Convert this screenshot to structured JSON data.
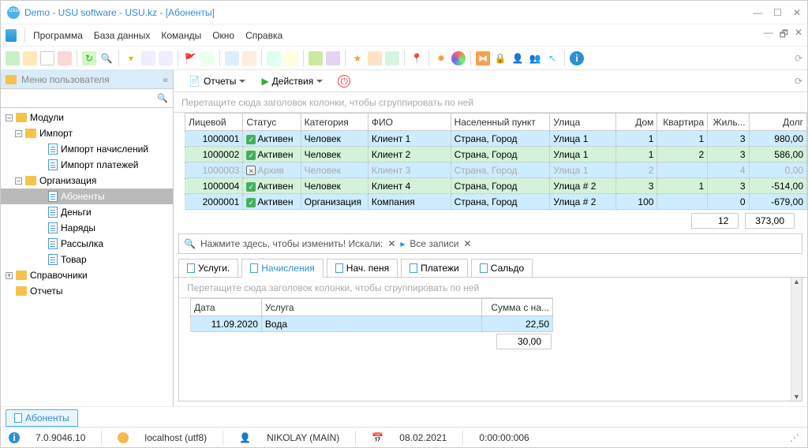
{
  "window": {
    "title": "Demo - USU software - USU.kz - [Абоненты]"
  },
  "menu": {
    "items": [
      "Программа",
      "База данных",
      "Команды",
      "Окно",
      "Справка"
    ]
  },
  "sidebar": {
    "header": "Меню пользователя",
    "tree": {
      "modules": "Модули",
      "import": "Импорт",
      "import_charges": "Импорт начислений",
      "import_payments": "Импорт платежей",
      "org": "Организация",
      "subscribers": "Абоненты",
      "money": "Деньги",
      "orders": "Наряды",
      "mail": "Рассылка",
      "goods": "Товар",
      "refs": "Справочники",
      "reports": "Отчеты"
    }
  },
  "subtoolbar": {
    "reports": "Отчеты",
    "actions": "Действия"
  },
  "group_hint": "Перетащите сюда заголовок колонки, чтобы сгруппировать по ней",
  "columns": [
    "Лицевой",
    "Статус",
    "Категория",
    "ФИО",
    "Населенный пункт",
    "Улица",
    "Дом",
    "Квартира",
    "Жиль...",
    "Долг"
  ],
  "rows": [
    {
      "acct": "1000001",
      "status": "Активен",
      "active": true,
      "cat": "Человек",
      "name": "Клиент 1",
      "city": "Страна, Город",
      "street": "Улица 1",
      "house": "1",
      "apt": "1",
      "res": "3",
      "debt": "980,00"
    },
    {
      "acct": "1000002",
      "status": "Активен",
      "active": true,
      "cat": "Человек",
      "name": "Клиент 2",
      "city": "Страна, Город",
      "street": "Улица 1",
      "house": "1",
      "apt": "2",
      "res": "3",
      "debt": "586,00"
    },
    {
      "acct": "1000003",
      "status": "Архив",
      "active": false,
      "cat": "Человек",
      "name": "Клиент 3",
      "city": "Страна, Город",
      "street": "Улица 1",
      "house": "2",
      "apt": "",
      "res": "4",
      "debt": "0,00"
    },
    {
      "acct": "1000004",
      "status": "Активен",
      "active": true,
      "cat": "Человек",
      "name": "Клиент 4",
      "city": "Страна, Город",
      "street": "Улица # 2",
      "house": "3",
      "apt": "1",
      "res": "3",
      "debt": "-514,00"
    },
    {
      "acct": "2000001",
      "status": "Активен",
      "active": true,
      "cat": "Организация",
      "name": "Компания",
      "city": "Страна, Город",
      "street": "Улица # 2",
      "house": "100",
      "apt": "",
      "res": "0",
      "debt": "-679,00"
    }
  ],
  "totals": {
    "residents": "12",
    "debt": "373,00"
  },
  "filter": {
    "prefix": "Нажмите здесь, чтобы изменить! Искали:",
    "all": "Все записи"
  },
  "detail_tabs": [
    "Услуги.",
    "Начисления",
    "Нач. пеня",
    "Платежи",
    "Сальдо"
  ],
  "detail_active_tab": 1,
  "detail_columns": [
    "Дата",
    "Услуга",
    "Сумма с на..."
  ],
  "detail_rows": [
    {
      "date": "11.09.2020",
      "service": "Вода",
      "amount": "22,50"
    }
  ],
  "detail_total": "30,00",
  "bottom_tab": "Абоненты",
  "status": {
    "version": "7.0.9046.10",
    "host": "localhost (utf8)",
    "user": "NIKOLAY (MAIN)",
    "date": "08.02.2021",
    "time": "0:00:00:006"
  }
}
